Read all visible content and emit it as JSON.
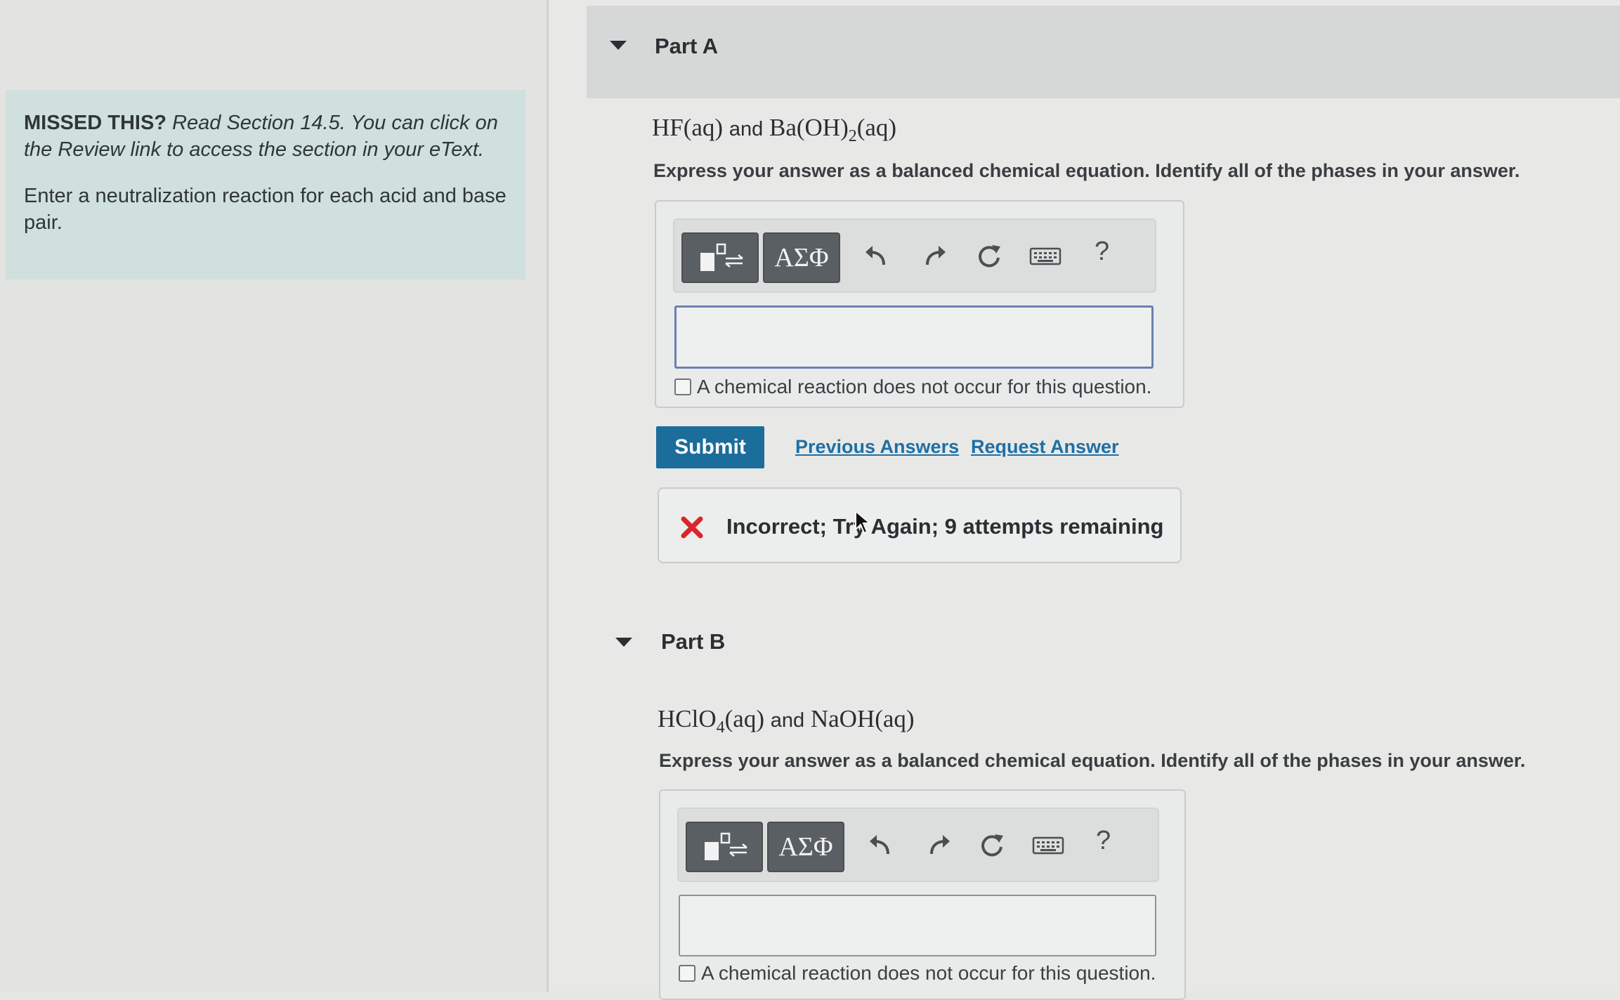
{
  "hint": {
    "missed_label": "MISSED THIS?",
    "missed_text": "Read Section 14.5. You can click on the Review link to access the section in your eText.",
    "instruction": "Enter a neutralization reaction for each acid and base pair."
  },
  "part_a": {
    "label": "Part A",
    "reactant_1": "HF(aq)",
    "and": "and",
    "reactant_2_pre": "Ba(OH)",
    "reactant_2_sub": "2",
    "reactant_2_post": "(aq)",
    "instruction": "Express your answer as a balanced chemical equation. Identify all of the phases in your answer.",
    "toolbar": {
      "templates_icon": "templates-icon",
      "greek_label": "ΑΣΦ",
      "undo_icon": "undo-icon",
      "redo_icon": "redo-icon",
      "reset_icon": "reset-icon",
      "keyboard_icon": "keyboard-icon",
      "help_label": "?"
    },
    "answer_value": "",
    "no_reaction_label": "A chemical reaction does not occur for this question.",
    "submit_label": "Submit",
    "previous_answers_label": "Previous Answers",
    "request_answer_label": "Request Answer",
    "feedback_icon": "x-icon",
    "feedback_text": "Incorrect; Try Again; 9 attempts remaining"
  },
  "part_b": {
    "label": "Part B",
    "reactant_1_pre": "HClO",
    "reactant_1_sub": "4",
    "reactant_1_post": "(aq)",
    "and": "and",
    "reactant_2": "NaOH(aq)",
    "instruction": "Express your answer as a balanced chemical equation. Identify all of the phases in your answer.",
    "toolbar": {
      "greek_label": "ΑΣΦ",
      "help_label": "?"
    },
    "answer_value": "",
    "no_reaction_label": "A chemical reaction does not occur for this question."
  },
  "colors": {
    "accent": "#1b6d9c",
    "link": "#1f6fa5",
    "hint_bg": "#cfe0dd",
    "error": "#d9252b",
    "input_border": "#6b7fb3"
  }
}
